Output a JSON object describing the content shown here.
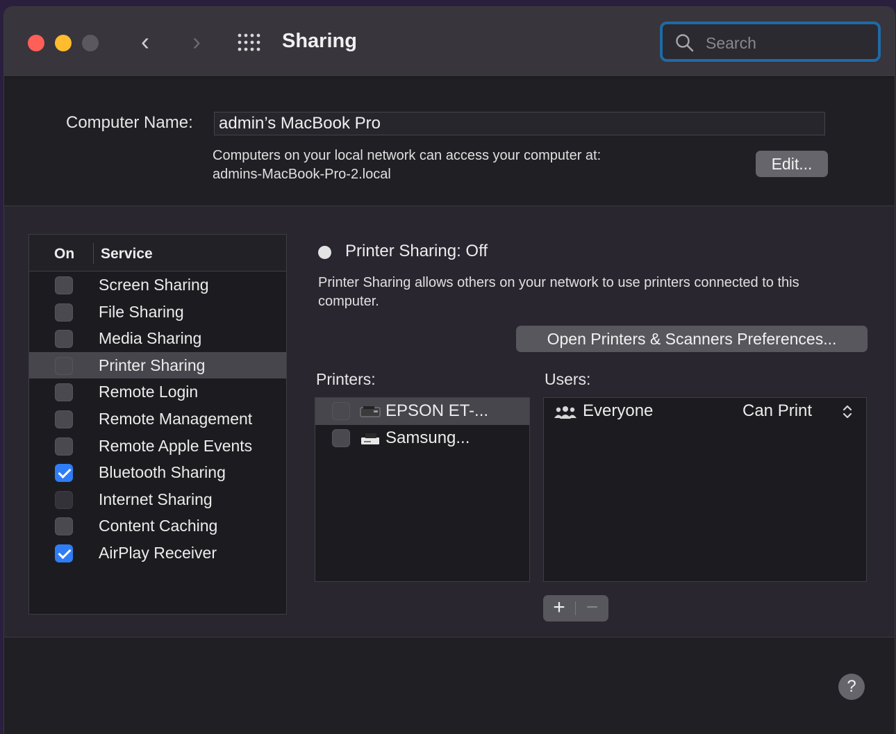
{
  "window": {
    "title": "Sharing",
    "search": {
      "placeholder": "Search",
      "value": ""
    }
  },
  "computer": {
    "name_label": "Computer Name:",
    "name_value": "admin’s MacBook Pro",
    "access_text": "Computers on your local network can access your computer at:",
    "hostname": "admins-MacBook-Pro-2.local",
    "edit_label": "Edit..."
  },
  "services": {
    "header_on": "On",
    "header_service": "Service",
    "items": [
      {
        "label": "Screen Sharing",
        "checked": false
      },
      {
        "label": "File Sharing",
        "checked": false
      },
      {
        "label": "Media Sharing",
        "checked": false
      },
      {
        "label": "Printer Sharing",
        "checked": false,
        "selected": true
      },
      {
        "label": "Remote Login",
        "checked": false
      },
      {
        "label": "Remote Management",
        "checked": false
      },
      {
        "label": "Remote Apple Events",
        "checked": false
      },
      {
        "label": "Bluetooth Sharing",
        "checked": true
      },
      {
        "label": "Internet Sharing",
        "checked": false,
        "disabled": true
      },
      {
        "label": "Content Caching",
        "checked": false
      },
      {
        "label": "AirPlay Receiver",
        "checked": true
      }
    ]
  },
  "detail": {
    "status": "Printer Sharing: Off",
    "description": "Printer Sharing allows others on your network to use printers connected to this computer.",
    "open_prefs_label": "Open Printers & Scanners Preferences...",
    "printers_label": "Printers:",
    "users_label": "Users:",
    "printers": [
      {
        "label": "EPSON ET-...",
        "checked": false,
        "selected": true
      },
      {
        "label": "Samsung...",
        "checked": false
      }
    ],
    "users": [
      {
        "label": "Everyone",
        "permission": "Can Print"
      }
    ],
    "add_label": "+",
    "remove_label": "−"
  },
  "help_label": "?",
  "colors": {
    "accent": "#2f7df6",
    "search_focus": "#1f6aa5"
  }
}
